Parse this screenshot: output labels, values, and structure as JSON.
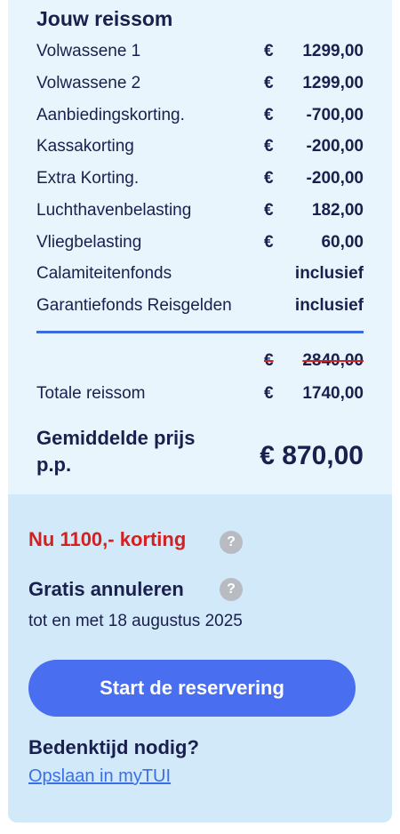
{
  "summary": {
    "title": "Jouw reissom",
    "rows": [
      {
        "label": "Volwassene 1",
        "currency": "€",
        "amount": "1299,00"
      },
      {
        "label": "Volwassene 2",
        "currency": "€",
        "amount": "1299,00"
      },
      {
        "label": "Aanbiedingskorting.",
        "currency": "€",
        "amount": "-700,00"
      },
      {
        "label": "Kassakorting",
        "currency": "€",
        "amount": "-200,00"
      },
      {
        "label": "Extra Korting.",
        "currency": "€",
        "amount": "-200,00"
      },
      {
        "label": "Luchthavenbelasting",
        "currency": "€",
        "amount": "182,00"
      },
      {
        "label": "Vliegbelasting",
        "currency": "€",
        "amount": "60,00"
      },
      {
        "label": "Calamiteitenfonds",
        "currency": "",
        "amount": "inclusief"
      },
      {
        "label": "Garantiefonds Reisgelden",
        "currency": "",
        "amount": "inclusief"
      }
    ],
    "old_total": {
      "currency": "€",
      "amount": "2840,00"
    },
    "total": {
      "label": "Totale reissom",
      "currency": "€",
      "amount": "1740,00"
    },
    "average": {
      "label": "Gemiddelde prijs p.p.",
      "price": "€ 870,00"
    }
  },
  "promo": {
    "discount_text": "Nu 1100,- korting",
    "help_icon": "?"
  },
  "cancellation": {
    "title": "Gratis annuleren",
    "help_icon": "?",
    "until": "tot en met 18 augustus 2025"
  },
  "cta": {
    "label": "Start de reservering"
  },
  "think": {
    "title": "Bedenktijd nodig?",
    "link": "Opslaan in myTUI"
  },
  "colors": {
    "accent": "#4a6ef0",
    "discount": "#d42020",
    "text": "#1a1f4e",
    "panel_top": "#e8f5fd",
    "panel_bottom": "#d1e9f9"
  }
}
